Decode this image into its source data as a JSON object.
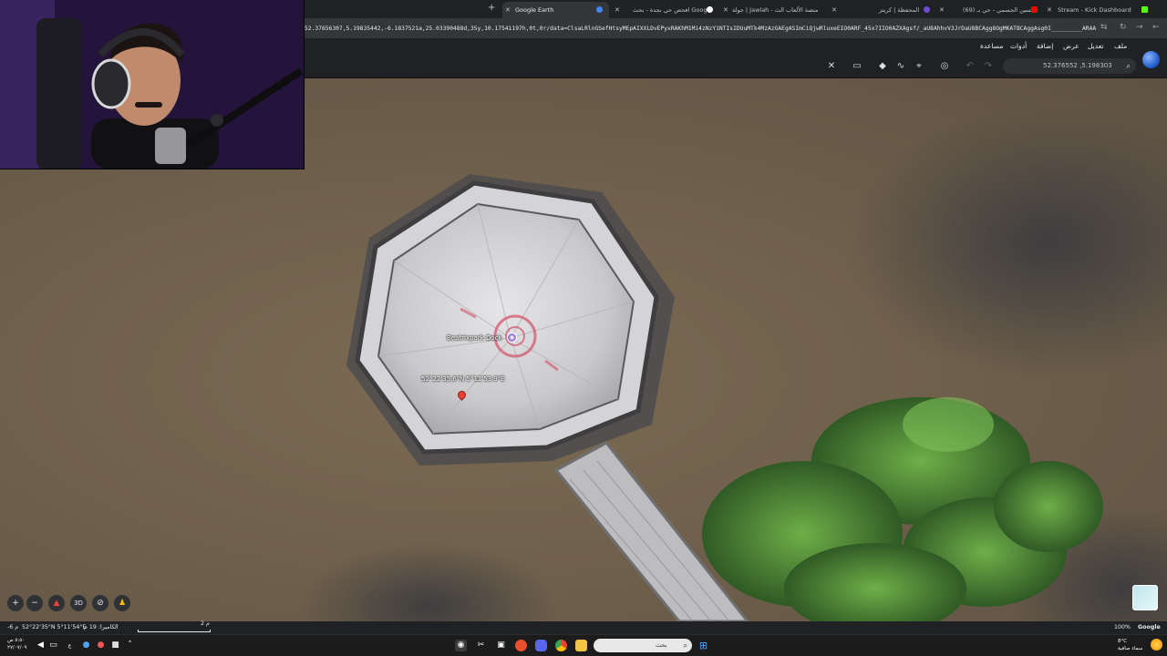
{
  "browser": {
    "tabs": [
      {
        "label": "Google Earth",
        "active": true
      },
      {
        "label": "افحص حي بجدة - بحث Google",
        "active": false
      },
      {
        "label": "جولة | Jawlah - منصة الألعاب الث",
        "active": false
      },
      {
        "label": "المحفظة | كريتز",
        "active": false
      },
      {
        "label": "(69) حسين الجسمي - حي بـ",
        "active": false
      },
      {
        "label": "Stream - Kick Dashboard",
        "active": false
      }
    ],
    "url": "52.37656307,5.19835442,-6.1837521a,25.03390488d,35y,10.17541197h,0t,0r/data=ClsaLRlnGSefHtsyMEpAIXXLDvEPyxRAKhM1Mi4zNzY1NTIsIDUuMTk4MzAzGAEgASImCiQjwRluxeEIO0ARF_45x7IIO0AZXAgsf/_aU8AhhvV3JrDaU8BCAgg8OgMKATBCAggAsg0I_________ARAA?hl=ar"
  },
  "menu": {
    "file": "ملف",
    "edit": "تعديل",
    "view": "عرض",
    "add": "إضافة",
    "tools": "أدوات",
    "help": "مساعدة"
  },
  "search": {
    "value": "52.376552 ,5.198303"
  },
  "map": {
    "place_label": "Beatrixpark Dock",
    "coord_label": "52°22'35.6\"N 5°11'53.9\"E",
    "controls": {
      "zoom_in": "+",
      "zoom_out": "−",
      "view_3d": "3D"
    }
  },
  "statusbar": {
    "camera": "الكاميرا: 19 م",
    "coords": "52°22'35\"N 5°11'54\"E",
    "elevation": "-6 م",
    "scale": "2 م",
    "zoom": "100%",
    "brand": "Google"
  },
  "taskbar": {
    "search_placeholder": "بحث",
    "time": "٥:٥٠ ص",
    "date": "٢٧/٠٧/٠٩",
    "lang": "ع",
    "temp": "8°C",
    "weather_text": "سماء صافية"
  },
  "colors": {
    "water": "#6e5f4b",
    "trees": "#4f8a36",
    "dock": "#cfcfcf",
    "pin": "#ea4335"
  }
}
